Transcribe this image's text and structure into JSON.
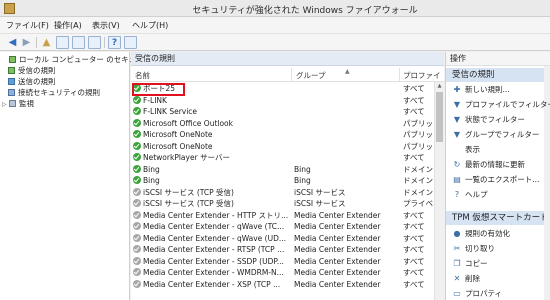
{
  "window": {
    "title": "セキュリティが強化された Windows ファイアウォール"
  },
  "menu": [
    "ファイル(F)",
    "操作(A)",
    "表示(V)",
    "ヘルプ(H)"
  ],
  "tree": [
    {
      "label": "ローカル コンピューター のセキュリティ",
      "indent": 0
    },
    {
      "label": "受信の規則",
      "indent": 1
    },
    {
      "label": "送信の規則",
      "indent": 1
    },
    {
      "label": "接続セキュリティの規則",
      "indent": 1
    },
    {
      "label": "監視",
      "indent": 1
    }
  ],
  "center": {
    "header": "受信の規則",
    "columns": {
      "name": "名前",
      "group": "グループ",
      "profile": "プロファイ"
    },
    "rows": [
      {
        "name": "ポート25",
        "group": "",
        "profile": "すべて",
        "enabled": true
      },
      {
        "name": "F-LINK",
        "group": "",
        "profile": "すべて",
        "enabled": true
      },
      {
        "name": "F-LINK Service",
        "group": "",
        "profile": "すべて",
        "enabled": true
      },
      {
        "name": "Microsoft Office Outlook",
        "group": "",
        "profile": "パブリック",
        "enabled": true
      },
      {
        "name": "Microsoft OneNote",
        "group": "",
        "profile": "パブリック",
        "enabled": true
      },
      {
        "name": "Microsoft OneNote",
        "group": "",
        "profile": "パブリック",
        "enabled": true
      },
      {
        "name": "NetworkPlayer サーバー",
        "group": "",
        "profile": "すべて",
        "enabled": true
      },
      {
        "name": "Bing",
        "group": "Bing",
        "profile": "ドメイン,",
        "enabled": true
      },
      {
        "name": "Bing",
        "group": "Bing",
        "profile": "ドメイン,",
        "enabled": true
      },
      {
        "name": "iSCSI サービス (TCP 受信)",
        "group": "iSCSI サービス",
        "profile": "ドメイン",
        "enabled": false
      },
      {
        "name": "iSCSI サービス (TCP 受信)",
        "group": "iSCSI サービス",
        "profile": "プライベー",
        "enabled": false
      },
      {
        "name": "Media Center Extender - HTTP ストリ...",
        "group": "Media Center Extender",
        "profile": "すべて",
        "enabled": false
      },
      {
        "name": "Media Center Extender - qWave (TC...",
        "group": "Media Center Extender",
        "profile": "すべて",
        "enabled": false
      },
      {
        "name": "Media Center Extender - qWave (UD...",
        "group": "Media Center Extender",
        "profile": "すべて",
        "enabled": false
      },
      {
        "name": "Media Center Extender - RTSP (TCP ...",
        "group": "Media Center Extender",
        "profile": "すべて",
        "enabled": false
      },
      {
        "name": "Media Center Extender - SSDP (UDP...",
        "group": "Media Center Extender",
        "profile": "すべて",
        "enabled": false
      },
      {
        "name": "Media Center Extender - WMDRM-N...",
        "group": "Media Center Extender",
        "profile": "すべて",
        "enabled": false
      },
      {
        "name": "Media Center Extender - XSP (TCP ...",
        "group": "Media Center Extender",
        "profile": "すべて",
        "enabled": false
      }
    ]
  },
  "actions": {
    "title": "操作",
    "group1": "受信の規則",
    "group1_items": [
      {
        "icon": "new-rule-icon",
        "glyph": "✚",
        "label": "新しい規則..."
      },
      {
        "icon": "filter-icon",
        "glyph": "▼",
        "label": "プロファイルでフィルター"
      },
      {
        "icon": "filter-icon",
        "glyph": "▼",
        "label": "状態でフィルター"
      },
      {
        "icon": "filter-icon",
        "glyph": "▼",
        "label": "グループでフィルター"
      },
      {
        "icon": "view-icon",
        "glyph": "",
        "label": "表示"
      },
      {
        "icon": "refresh-icon",
        "glyph": "↻",
        "label": "最新の情報に更新"
      },
      {
        "icon": "export-icon",
        "glyph": "▤",
        "label": "一覧のエクスポート..."
      },
      {
        "icon": "help-icon",
        "glyph": "?",
        "label": "ヘルプ"
      }
    ],
    "group2": "TPM 仮想スマートカード管",
    "group2_items": [
      {
        "icon": "enable-rule-icon",
        "glyph": "●",
        "label": "規則の有効化"
      },
      {
        "icon": "cut-icon",
        "glyph": "✂",
        "label": "切り取り"
      },
      {
        "icon": "copy-icon",
        "glyph": "❐",
        "label": "コピー"
      },
      {
        "icon": "delete-icon",
        "glyph": "✕",
        "label": "削除"
      },
      {
        "icon": "properties-icon",
        "glyph": "▭",
        "label": "プロパティ"
      }
    ]
  }
}
